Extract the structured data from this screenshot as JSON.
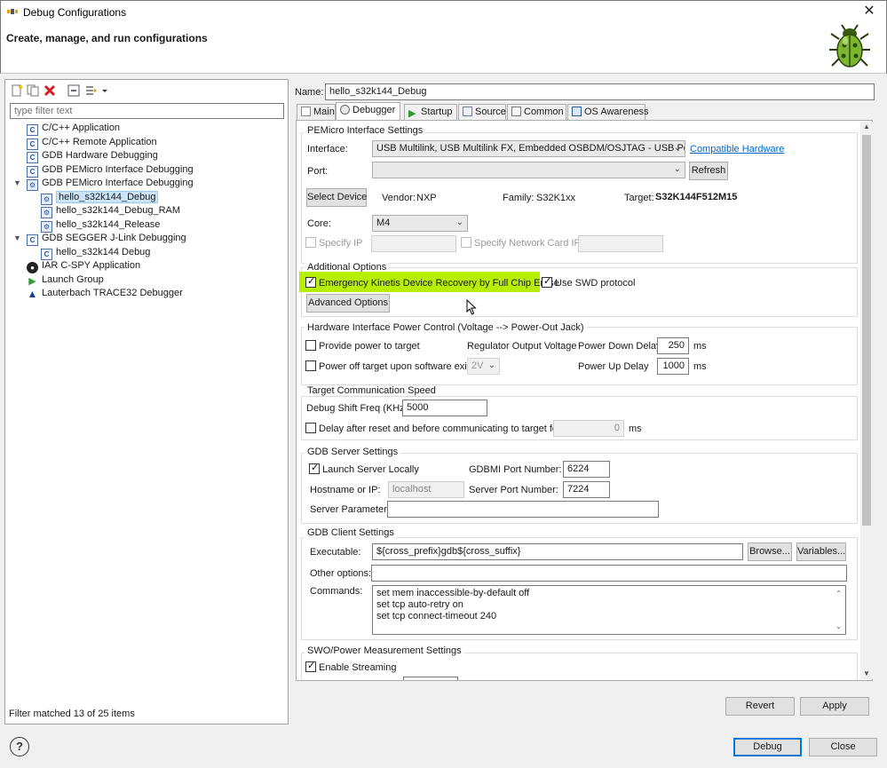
{
  "window": {
    "title": "Debug Configurations",
    "close_glyph": "✕",
    "header_title": "Create, manage, and run configurations",
    "header_icon": "bug-icon"
  },
  "left": {
    "filter_placeholder": "type filter text",
    "tree": [
      {
        "label": "C/C++ Application",
        "icon": "c-app-icon",
        "level": 0
      },
      {
        "label": "C/C++ Remote Application",
        "icon": "c-app-icon",
        "level": 0
      },
      {
        "label": "GDB Hardware Debugging",
        "icon": "c-app-icon",
        "level": 0
      },
      {
        "label": "GDB PEMicro Interface Debugging",
        "icon": "c-app-icon",
        "level": 0
      },
      {
        "label": "GDB PEMicro Interface Debugging",
        "icon": "debug-group-icon",
        "level": 0,
        "expanded": true
      },
      {
        "label": "hello_s32k144_Debug",
        "icon": "debug-config-icon",
        "level": 1,
        "selected": true
      },
      {
        "label": "hello_s32k144_Debug_RAM",
        "icon": "debug-config-icon",
        "level": 1
      },
      {
        "label": "hello_s32k144_Release",
        "icon": "debug-config-icon",
        "level": 1
      },
      {
        "label": "GDB SEGGER J-Link Debugging",
        "icon": "c-app-icon",
        "level": 0,
        "expanded": true
      },
      {
        "label": "hello_s32k144 Debug",
        "icon": "c-app-icon",
        "level": 1
      },
      {
        "label": "IAR C-SPY Application",
        "icon": "iar-icon",
        "level": 0
      },
      {
        "label": "Launch Group",
        "icon": "launch-group-icon",
        "level": 0
      },
      {
        "label": "Lauterbach TRACE32 Debugger",
        "icon": "trace32-icon",
        "level": 0
      }
    ],
    "filter_status": "Filter matched 13 of 25 items"
  },
  "right": {
    "name_label": "Name:",
    "name_value": "hello_s32k144_Debug",
    "tabs": [
      {
        "label": "Main",
        "icon": "main-tab-icon"
      },
      {
        "label": "Debugger",
        "icon": "debugger-tab-icon",
        "active": true
      },
      {
        "label": "Startup",
        "icon": "startup-tab-icon"
      },
      {
        "label": "Source",
        "icon": "source-tab-icon"
      },
      {
        "label": "Common",
        "icon": "common-tab-icon"
      },
      {
        "label": "OS Awareness",
        "icon": "os-awareness-tab-icon"
      }
    ],
    "pemicro": {
      "title": "PEMicro Interface Settings",
      "interface_label": "Interface:",
      "interface_value": "USB Multilink, USB Multilink FX, Embedded OSBDM/OSJTAG - USB Port",
      "compatible_link": "Compatible Hardware",
      "port_label": "Port:",
      "port_value": "",
      "refresh": "Refresh",
      "select_device": "Select Device",
      "vendor_label": "Vendor:",
      "vendor_value": "NXP",
      "family_label": "Family:",
      "family_value": "S32K1xx",
      "target_label": "Target:",
      "target_value": "S32K144F512M15",
      "core_label": "Core:",
      "core_value": "M4",
      "specify_ip": "Specify IP",
      "specify_nic": "Specify Network Card IP"
    },
    "additional": {
      "title": "Additional Options",
      "emergency": "Emergency Kinetis Device Recovery by Full Chip Erase",
      "emergency_checked": true,
      "swd": "Use SWD protocol",
      "swd_checked": true,
      "advanced": "Advanced Options",
      "highlight_color": "#b6f000"
    },
    "power": {
      "title": "Hardware Interface Power Control (Voltage --> Power-Out Jack)",
      "provide_power": "Provide power to target",
      "power_off": "Power off target upon software exit",
      "regulator_label": "Regulator Output Voltage",
      "regulator_value": "2V",
      "power_down_label": "Power Down Delay",
      "power_down_value": "250",
      "power_up_label": "Power Up Delay",
      "power_up_value": "1000",
      "unit_ms": "ms"
    },
    "speed": {
      "title": "Target Communication Speed",
      "shift_label": "Debug Shift Freq (KHz)",
      "shift_value": "5000",
      "delay_label": "Delay after reset and before communicating to target for",
      "delay_value": "0",
      "unit_ms": "ms"
    },
    "gdb_server": {
      "title": "GDB Server Settings",
      "launch_locally": "Launch Server Locally",
      "launch_checked": true,
      "gdbmi_label": "GDBMI Port Number:",
      "gdbmi_value": "6224",
      "hostname_label": "Hostname or IP:",
      "hostname_value": "localhost",
      "server_port_label": "Server Port Number:",
      "server_port_value": "7224",
      "params_label": "Server Parameters:",
      "params_value": ""
    },
    "gdb_client": {
      "title": "GDB Client Settings",
      "exec_label": "Executable:",
      "exec_value": "${cross_prefix}gdb${cross_suffix}",
      "browse": "Browse...",
      "variables": "Variables...",
      "other_label": "Other options:",
      "other_value": "",
      "commands_label": "Commands:",
      "commands": [
        "set mem inaccessible-by-default off",
        "set tcp auto-retry on",
        "set tcp connect-timeout 240"
      ]
    },
    "swo": {
      "title": "SWO/Power Measurement Settings",
      "enable_streaming": "Enable Streaming",
      "enable_checked": true
    },
    "revert": "Revert",
    "apply": "Apply"
  },
  "footer": {
    "help": "?",
    "debug": "Debug",
    "close": "Close"
  }
}
